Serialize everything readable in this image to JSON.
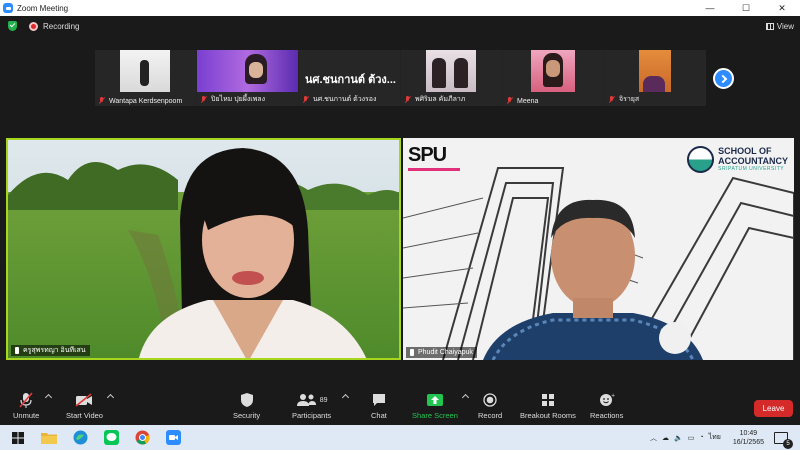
{
  "window": {
    "title": "Zoom Meeting",
    "controls": [
      "—",
      "☐",
      "✕"
    ]
  },
  "status": {
    "recording_label": "Recording",
    "view_label": "View"
  },
  "thumbnails": [
    {
      "name": "Wantapa Kerdsenpoom",
      "muted": true
    },
    {
      "name": "ปิยไหม ปุยผึ้งเพลง",
      "muted": true
    },
    {
      "name": "นศ.ชนกานต์ ต้วงรอง",
      "big_label": "นศ.ชนกานต์ ต้วง...",
      "muted": true
    },
    {
      "name": "พศิริมล คัมภีลาภ",
      "muted": true
    },
    {
      "name": "Meena",
      "muted": true
    },
    {
      "name": "จิรายุส",
      "muted": true
    }
  ],
  "videos": {
    "left": {
      "name": "ครูสุพรทญา อินทีเสน"
    },
    "right": {
      "name": "Phudit Chaiyapuk",
      "logo_spu": "SPU",
      "logo_acc_line1": "SCHOOL OF",
      "logo_acc_line2": "ACCOUNTANCY",
      "logo_acc_line3": "SRIPATUM UNIVERSITY"
    }
  },
  "toolbar": {
    "unmute": "Unmute",
    "start_video": "Start Video",
    "security": "Security",
    "participants": "Participants",
    "participants_count": "89",
    "chat": "Chat",
    "share_screen": "Share Screen",
    "record": "Record",
    "breakout_rooms": "Breakout Rooms",
    "reactions": "Reactions",
    "leave": "Leave"
  },
  "taskbar": {
    "language": "ไทย",
    "time": "10:49",
    "date": "16/1/2565",
    "notification_count": "5"
  },
  "colors": {
    "accent_blue": "#2d8cff",
    "active_speaker": "#a7d61f",
    "leave_red": "#d42a2a",
    "share_green": "#23c552"
  }
}
